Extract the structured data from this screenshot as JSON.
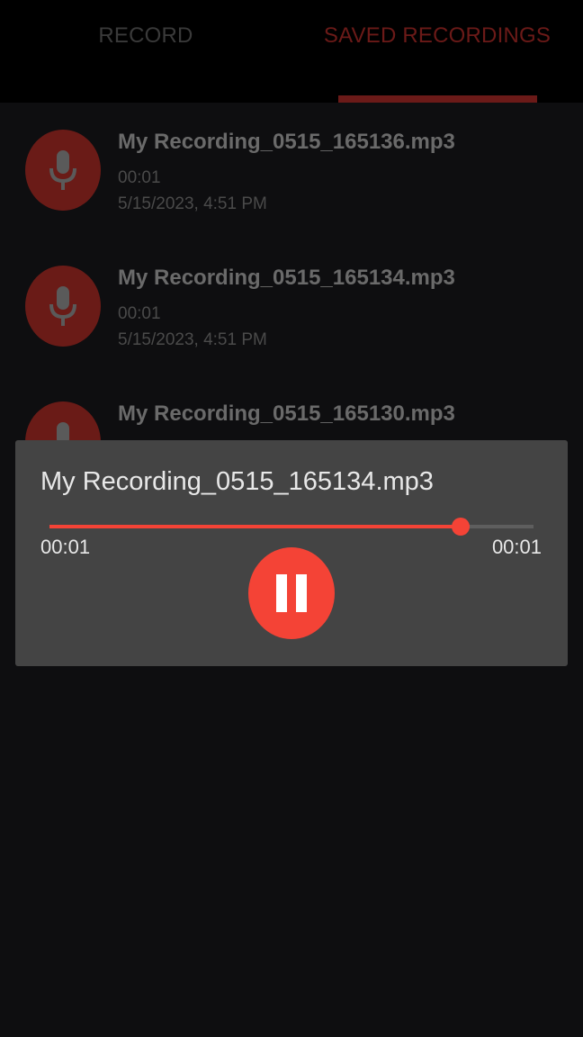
{
  "tabs": {
    "record_label": "RECORD",
    "saved_label": "SAVED RECORDINGS",
    "active": "saved"
  },
  "recordings": [
    {
      "name": "My Recording_0515_165136.mp3",
      "duration": "00:01",
      "date": "5/15/2023, 4:51 PM"
    },
    {
      "name": "My Recording_0515_165134.mp3",
      "duration": "00:01",
      "date": "5/15/2023, 4:51 PM"
    },
    {
      "name": "My Recording_0515_165130.mp3",
      "duration": "",
      "date": ""
    }
  ],
  "player": {
    "title": "My Recording_0515_165134.mp3",
    "elapsed": "00:01",
    "total": "00:01",
    "progress": 0.85,
    "state": "playing",
    "icon": "pause-icon"
  },
  "colors": {
    "accent": "#f44336",
    "accent_dim": "#6b1a18",
    "background": "#0e0e10",
    "dialog": "#444444"
  }
}
